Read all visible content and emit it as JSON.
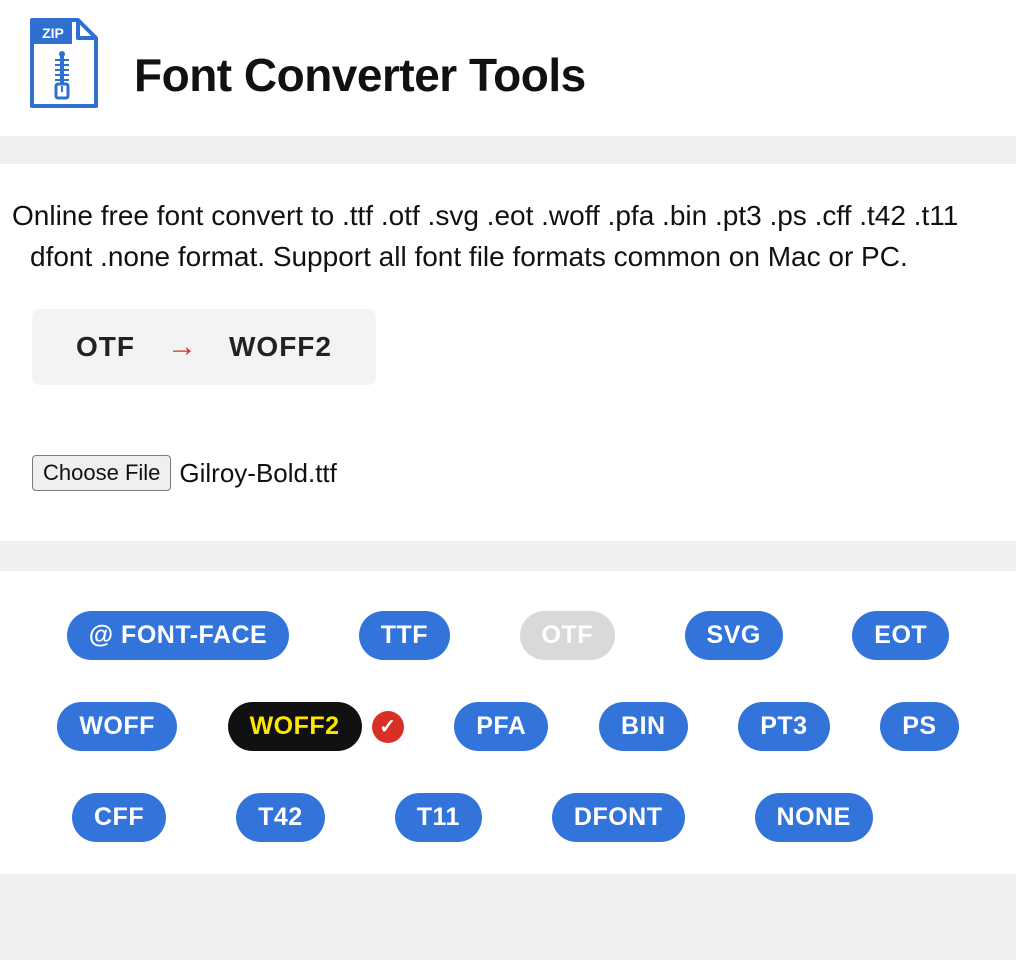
{
  "header": {
    "zip_label": "ZIP",
    "title": "Font Converter Tools"
  },
  "description": "Online free font convert to .ttf .otf .svg .eot .woff .pfa .bin .pt3 .ps .cff .t42 .t11 dfont .none format. Support all font file formats common on Mac or PC.",
  "conversion": {
    "from": "OTF",
    "arrow": "→",
    "to": "WOFF2"
  },
  "file": {
    "button": "Choose File",
    "name": "Gilroy-Bold.ttf"
  },
  "formats": {
    "row1": [
      {
        "label": "@ FONT-FACE",
        "state": "normal"
      },
      {
        "label": "TTF",
        "state": "normal"
      },
      {
        "label": "OTF",
        "state": "disabled"
      },
      {
        "label": "SVG",
        "state": "normal"
      },
      {
        "label": "EOT",
        "state": "normal"
      }
    ],
    "row2": [
      {
        "label": "WOFF",
        "state": "normal"
      },
      {
        "label": "WOFF2",
        "state": "active",
        "check": true
      },
      {
        "label": "PFA",
        "state": "normal"
      },
      {
        "label": "BIN",
        "state": "normal"
      },
      {
        "label": "PT3",
        "state": "normal"
      },
      {
        "label": "PS",
        "state": "normal"
      }
    ],
    "row3": [
      {
        "label": "CFF",
        "state": "normal"
      },
      {
        "label": "T42",
        "state": "normal"
      },
      {
        "label": "T11",
        "state": "normal"
      },
      {
        "label": "DFONT",
        "state": "normal"
      },
      {
        "label": "NONE",
        "state": "normal"
      }
    ]
  }
}
